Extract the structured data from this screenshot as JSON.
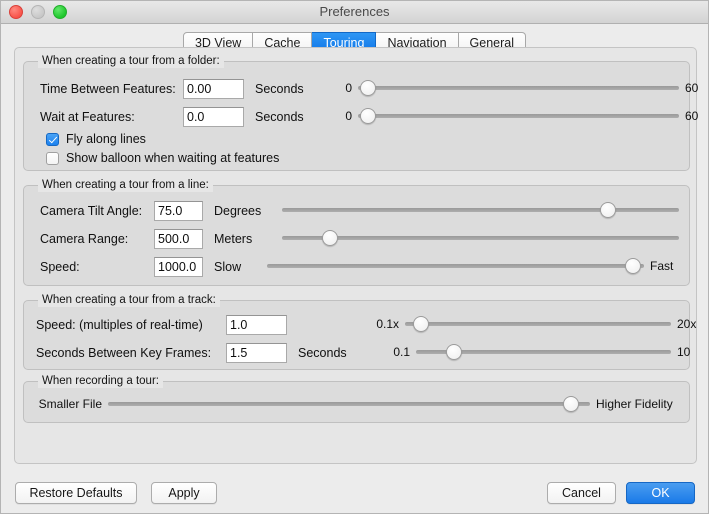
{
  "window": {
    "title": "Preferences",
    "traffic_lights": [
      "close",
      "minimize",
      "zoom"
    ]
  },
  "tabs": [
    {
      "label": "3D View",
      "active": false
    },
    {
      "label": "Cache",
      "active": false
    },
    {
      "label": "Touring",
      "active": true
    },
    {
      "label": "Navigation",
      "active": false
    },
    {
      "label": "General",
      "active": false
    }
  ],
  "sections": {
    "folder": {
      "title": "When creating a tour from a folder:",
      "rows": [
        {
          "label": "Time Between Features:",
          "value": "0.00",
          "unit": "Seconds",
          "slider_min_label": "0",
          "slider_max_label": "60",
          "slider_percent": 3
        },
        {
          "label": "Wait at Features:",
          "value": "0.0",
          "unit": "Seconds",
          "slider_min_label": "0",
          "slider_max_label": "60",
          "slider_percent": 3
        }
      ],
      "checkboxes": [
        {
          "label": "Fly along lines",
          "checked": true
        },
        {
          "label": "Show balloon when waiting at features",
          "checked": false
        }
      ]
    },
    "line": {
      "title": "When creating a tour from a line:",
      "rows": [
        {
          "label": "Camera Tilt Angle:",
          "value": "75.0",
          "unit": "Degrees",
          "slider_min_label": "",
          "slider_max_label": "",
          "slider_percent": 82
        },
        {
          "label": "Camera Range:",
          "value": "500.0",
          "unit": "Meters",
          "slider_min_label": "",
          "slider_max_label": "",
          "slider_percent": 12
        },
        {
          "label": "Speed:",
          "value": "1000.0",
          "unit": "Slow",
          "slider_min_label": "",
          "slider_max_label": "Fast",
          "slider_percent": 97
        }
      ]
    },
    "track": {
      "title": "When creating a tour from a track:",
      "rows": [
        {
          "label": "Speed: (multiples of real-time)",
          "value": "1.0",
          "unit": "",
          "slider_min_label": "0.1x",
          "slider_max_label": "20x",
          "slider_percent": 6
        },
        {
          "label": "Seconds Between Key Frames:",
          "value": "1.5",
          "unit": "Seconds",
          "slider_min_label": "0.1",
          "slider_max_label": "10",
          "slider_percent": 15
        }
      ]
    },
    "recording": {
      "title": "When recording a tour:",
      "slider_min_label": "Smaller File",
      "slider_max_label": "Higher Fidelity",
      "slider_percent": 96
    }
  },
  "buttons": {
    "restore_defaults": "Restore Defaults",
    "apply": "Apply",
    "cancel": "Cancel",
    "ok": "OK"
  },
  "colors": {
    "accent": "#1a7ae8",
    "window_bg": "#ececec",
    "group_bg": "#dcdcdc"
  }
}
